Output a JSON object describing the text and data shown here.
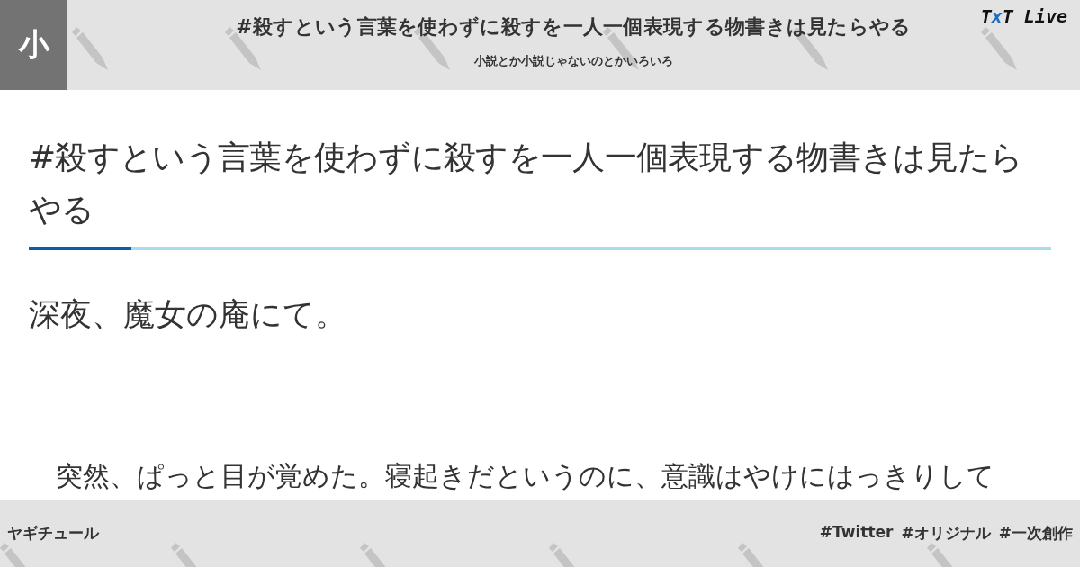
{
  "header": {
    "badge": "小",
    "title": "#殺すという言葉を使わずに殺すを一人一個表現する物書きは見たらやる",
    "subtitle": "小説とか小説じゃないのとかいろいろ",
    "logo": [
      {
        "text": "T",
        "accent": false
      },
      {
        "text": "x",
        "accent": true
      },
      {
        "text": "T Live",
        "accent": false
      }
    ]
  },
  "article": {
    "title": "#殺すという言葉を使わずに殺すを一人一個表現する物書きは見たらやる",
    "heading": "深夜、魔女の庵にて。",
    "paragraph": "突然、ぱっと目が覚めた。寝起きだというのに、意識はやけにはっきりして"
  },
  "footer": {
    "author": "ヤギチュール",
    "tags": [
      "#Twitter",
      "#オリジナル",
      "#一次創作"
    ]
  }
}
